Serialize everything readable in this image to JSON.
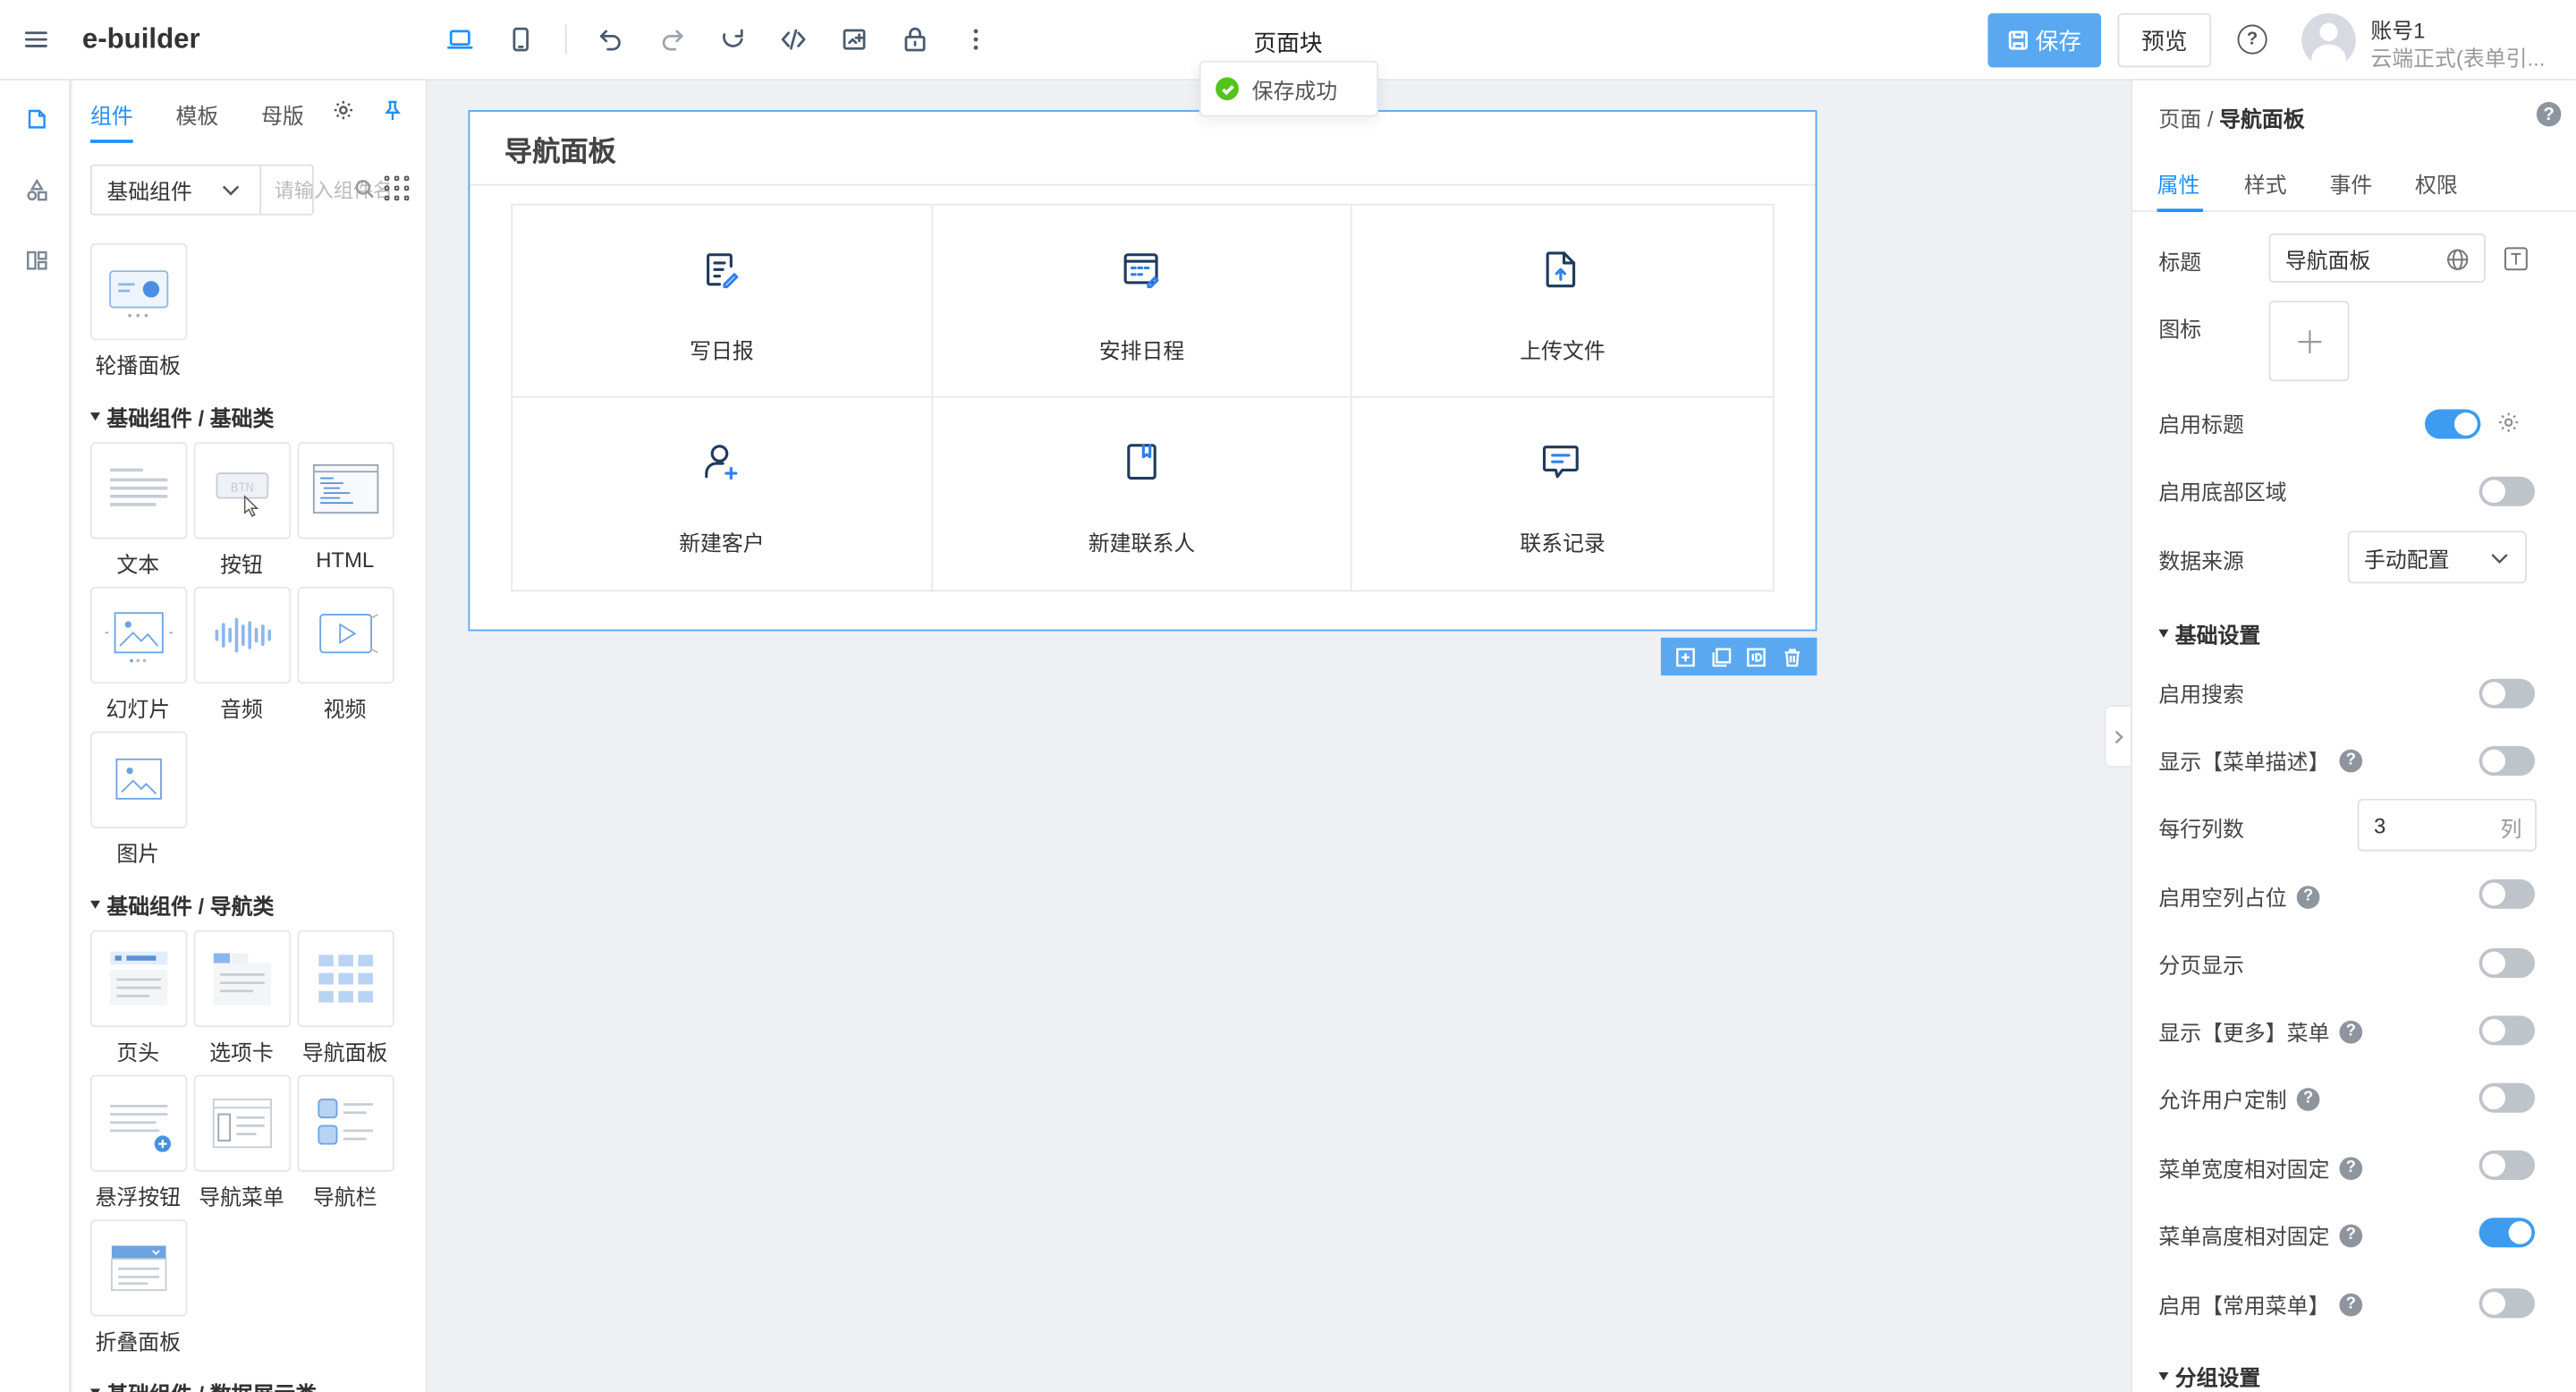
{
  "app": {
    "brand": "e-builder",
    "page_title": "页面块"
  },
  "toolbar": {
    "save_label": "保存",
    "preview_label": "预览",
    "help_glyph": "?",
    "icons": [
      "desktop-icon",
      "mobile-icon",
      "undo-icon",
      "redo-icon",
      "refresh-icon",
      "code-icon",
      "screenshot-icon",
      "lock-icon",
      "more-icon"
    ]
  },
  "account": {
    "name": "账号1",
    "subtitle": "云端正式(表单引..."
  },
  "toast": {
    "message": "保存成功"
  },
  "component_panel": {
    "tabs": [
      "组件",
      "模板",
      "母版"
    ],
    "active_tab": "组件",
    "select_value": "基础组件",
    "search_placeholder": "请输入组件名称",
    "top_items": [
      {
        "label": "轮播面板",
        "icon": "carousel-icon"
      }
    ],
    "sections": [
      {
        "title": "基础组件 / 基础类",
        "items": [
          {
            "label": "文本",
            "icon": "text-icon"
          },
          {
            "label": "按钮",
            "icon": "button-icon"
          },
          {
            "label": "HTML",
            "icon": "html-icon"
          },
          {
            "label": "幻灯片",
            "icon": "slideshow-icon"
          },
          {
            "label": "音频",
            "icon": "audio-icon"
          },
          {
            "label": "视频",
            "icon": "video-icon"
          },
          {
            "label": "图片",
            "icon": "image-icon"
          }
        ]
      },
      {
        "title": "基础组件 / 导航类",
        "items": [
          {
            "label": "页头",
            "icon": "page-header-icon"
          },
          {
            "label": "选项卡",
            "icon": "tabs-icon"
          },
          {
            "label": "导航面板",
            "icon": "nav-panel-icon"
          },
          {
            "label": "悬浮按钮",
            "icon": "float-button-icon"
          },
          {
            "label": "导航菜单",
            "icon": "nav-menu-icon"
          },
          {
            "label": "导航栏",
            "icon": "nav-bar-icon"
          },
          {
            "label": "折叠面板",
            "icon": "collapse-panel-icon"
          }
        ]
      },
      {
        "title": "基础组件 / 数据展示类",
        "items": []
      }
    ]
  },
  "canvas": {
    "nav_panel": {
      "title": "导航面板",
      "items": [
        {
          "label": "写日报",
          "icon": "daily-report-icon"
        },
        {
          "label": "安排日程",
          "icon": "schedule-icon"
        },
        {
          "label": "上传文件",
          "icon": "upload-file-icon"
        },
        {
          "label": "新建客户",
          "icon": "new-customer-icon"
        },
        {
          "label": "新建联系人",
          "icon": "new-contact-icon"
        },
        {
          "label": "联系记录",
          "icon": "contact-record-icon"
        }
      ]
    },
    "selection_tools": [
      "add-icon",
      "copy-icon",
      "id-icon",
      "delete-icon"
    ]
  },
  "props_panel": {
    "breadcrumb_root": "页面",
    "breadcrumb_sep": " / ",
    "breadcrumb_current": "导航面板",
    "tabs": [
      "属性",
      "样式",
      "事件",
      "权限"
    ],
    "active_tab": "属性",
    "title_label": "标题",
    "title_value": "导航面板",
    "icon_label": "图标",
    "enable_title": {
      "label": "启用标题",
      "on": true
    },
    "enable_footer": {
      "label": "启用底部区域",
      "on": false
    },
    "data_source": {
      "label": "数据来源",
      "value": "手动配置"
    },
    "basic_section": "基础设置",
    "columns": {
      "label": "每行列数",
      "value": "3",
      "unit": "列"
    },
    "toggles": [
      {
        "label": "启用搜索",
        "on": false,
        "help": false
      },
      {
        "label": "显示【菜单描述】",
        "on": false,
        "help": true
      },
      {
        "label": "启用空列占位",
        "on": false,
        "help": true
      },
      {
        "label": "分页显示",
        "on": false,
        "help": false
      },
      {
        "label": "显示【更多】菜单",
        "on": false,
        "help": true
      },
      {
        "label": "允许用户定制",
        "on": false,
        "help": true
      },
      {
        "label": "菜单宽度相对固定",
        "on": false,
        "help": true
      },
      {
        "label": "菜单高度相对固定",
        "on": true,
        "help": true
      },
      {
        "label": "启用【常用菜单】",
        "on": false,
        "help": true
      }
    ],
    "group_section": "分组设置"
  }
}
